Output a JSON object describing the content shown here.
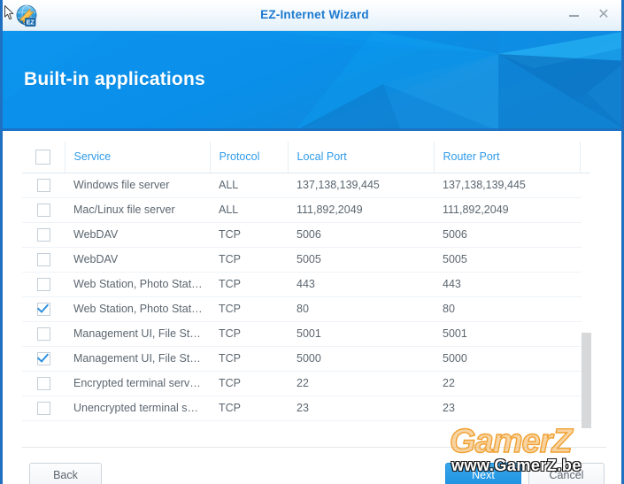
{
  "window": {
    "title": "EZ-Internet Wizard",
    "icon": "ez-internet-globe-icon",
    "minimize_label": "–",
    "close_label": "✕"
  },
  "banner": {
    "heading": "Built-in applications"
  },
  "table": {
    "select_all_checked": false,
    "columns": [
      {
        "key": "service",
        "label": "Service"
      },
      {
        "key": "protocol",
        "label": "Protocol"
      },
      {
        "key": "local",
        "label": "Local Port"
      },
      {
        "key": "router",
        "label": "Router Port"
      }
    ],
    "rows": [
      {
        "checked": false,
        "service": "Windows file server",
        "protocol": "ALL",
        "local": "137,138,139,445",
        "router": "137,138,139,445"
      },
      {
        "checked": false,
        "service": "Mac/Linux file server",
        "protocol": "ALL",
        "local": "111,892,2049",
        "router": "111,892,2049"
      },
      {
        "checked": false,
        "service": "WebDAV",
        "protocol": "TCP",
        "local": "5006",
        "router": "5006"
      },
      {
        "checked": false,
        "service": "WebDAV",
        "protocol": "TCP",
        "local": "5005",
        "router": "5005"
      },
      {
        "checked": false,
        "service": "Web Station, Photo Stat…",
        "protocol": "TCP",
        "local": "443",
        "router": "443"
      },
      {
        "checked": true,
        "service": "Web Station, Photo Stat…",
        "protocol": "TCP",
        "local": "80",
        "router": "80"
      },
      {
        "checked": false,
        "service": "Management UI, File St…",
        "protocol": "TCP",
        "local": "5001",
        "router": "5001"
      },
      {
        "checked": true,
        "service": "Management UI, File St…",
        "protocol": "TCP",
        "local": "5000",
        "router": "5000"
      },
      {
        "checked": false,
        "service": "Encrypted terminal serv…",
        "protocol": "TCP",
        "local": "22",
        "router": "22"
      },
      {
        "checked": false,
        "service": "Unencrypted terminal s…",
        "protocol": "TCP",
        "local": "23",
        "router": "23"
      }
    ]
  },
  "footer": {
    "back_label": "Back",
    "next_label": "Next",
    "cancel_label": "Cancel"
  },
  "watermark": {
    "logo_text": "GamerZ",
    "url_text": "www.GamerZ.be"
  },
  "colors": {
    "accent_blue": "#1b8fdf",
    "header_link_blue": "#2f9ae8",
    "banner_blue": "#0a8ee8",
    "title_blue": "#1b79d0",
    "text_grey": "#5b6670",
    "watermark_orange": "#f0a030"
  }
}
